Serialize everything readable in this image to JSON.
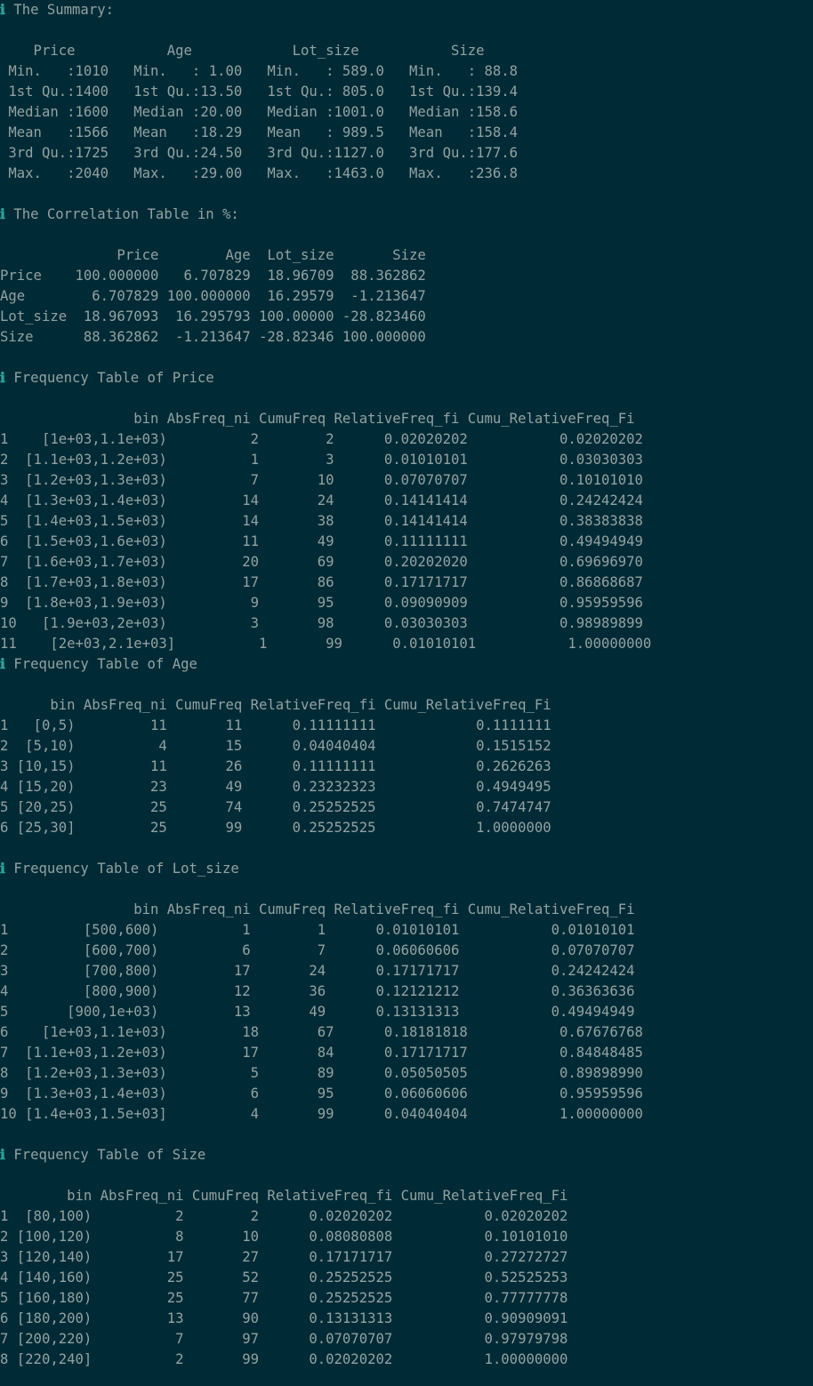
{
  "info_icon": "ℹ",
  "sections": [
    {
      "title": "The Summary:",
      "lines": [
        "",
        "    Price           Age            Lot_size           Size      ",
        " Min.   :1010   Min.   : 1.00   Min.   : 589.0   Min.   : 88.8  ",
        " 1st Qu.:1400   1st Qu.:13.50   1st Qu.: 805.0   1st Qu.:139.4  ",
        " Median :1600   Median :20.00   Median :1001.0   Median :158.6  ",
        " Mean   :1566   Mean   :18.29   Mean   : 989.5   Mean   :158.4  ",
        " 3rd Qu.:1725   3rd Qu.:24.50   3rd Qu.:1127.0   3rd Qu.:177.6  ",
        " Max.   :2040   Max.   :29.00   Max.   :1463.0   Max.   :236.8  ",
        ""
      ]
    },
    {
      "title": "The Correlation Table in %:",
      "lines": [
        "",
        "              Price        Age  Lot_size       Size",
        "Price    100.000000   6.707829  18.96709  88.362862",
        "Age        6.707829 100.000000  16.29579  -1.213647",
        "Lot_size  18.967093  16.295793 100.00000 -28.823460",
        "Size      88.362862  -1.213647 -28.82346 100.000000",
        ""
      ]
    },
    {
      "title": "Frequency Table of Price",
      "lines": [
        "",
        "                bin AbsFreq_ni CumuFreq RelativeFreq_fi Cumu_RelativeFreq_Fi",
        "1    [1e+03,1.1e+03)          2        2      0.02020202           0.02020202",
        "2  [1.1e+03,1.2e+03)          1        3      0.01010101           0.03030303",
        "3  [1.2e+03,1.3e+03)          7       10      0.07070707           0.10101010",
        "4  [1.3e+03,1.4e+03)         14       24      0.14141414           0.24242424",
        "5  [1.4e+03,1.5e+03)         14       38      0.14141414           0.38383838",
        "6  [1.5e+03,1.6e+03)         11       49      0.11111111           0.49494949",
        "7  [1.6e+03,1.7e+03)         20       69      0.20202020           0.69696970",
        "8  [1.7e+03,1.8e+03)         17       86      0.17171717           0.86868687",
        "9  [1.8e+03,1.9e+03)          9       95      0.09090909           0.95959596",
        "10   [1.9e+03,2e+03)          3       98      0.03030303           0.98989899",
        "11    [2e+03,2.1e+03]          1       99      0.01010101           1.00000000"
      ]
    },
    {
      "title": "Frequency Table of Age",
      "lines": [
        "",
        "      bin AbsFreq_ni CumuFreq RelativeFreq_fi Cumu_RelativeFreq_Fi",
        "1   [0,5)         11       11      0.11111111            0.1111111",
        "2  [5,10)          4       15      0.04040404            0.1515152",
        "3 [10,15)         11       26      0.11111111            0.2626263",
        "4 [15,20)         23       49      0.23232323            0.4949495",
        "5 [20,25)         25       74      0.25252525            0.7474747",
        "6 [25,30]         25       99      0.25252525            1.0000000",
        ""
      ]
    },
    {
      "title": "Frequency Table of Lot_size",
      "lines": [
        "",
        "                bin AbsFreq_ni CumuFreq RelativeFreq_fi Cumu_RelativeFreq_Fi",
        "1         [500,600)          1        1      0.01010101           0.01010101",
        "2         [600,700)          6        7      0.06060606           0.07070707",
        "3         [700,800)         17       24      0.17171717           0.24242424",
        "4         [800,900)         12       36      0.12121212           0.36363636",
        "5       [900,1e+03)         13       49      0.13131313           0.49494949",
        "6    [1e+03,1.1e+03)         18       67      0.18181818           0.67676768",
        "7  [1.1e+03,1.2e+03)         17       84      0.17171717           0.84848485",
        "8  [1.2e+03,1.3e+03)          5       89      0.05050505           0.89898990",
        "9  [1.3e+03,1.4e+03)          6       95      0.06060606           0.95959596",
        "10 [1.4e+03,1.5e+03]          4       99      0.04040404           1.00000000",
        ""
      ]
    },
    {
      "title": "Frequency Table of Size",
      "lines": [
        "",
        "        bin AbsFreq_ni CumuFreq RelativeFreq_fi Cumu_RelativeFreq_Fi",
        "1  [80,100)          2        2      0.02020202           0.02020202",
        "2 [100,120)          8       10      0.08080808           0.10101010",
        "3 [120,140)         17       27      0.17171717           0.27272727",
        "4 [140,160)         25       52      0.25252525           0.52525253",
        "5 [160,180)         25       77      0.25252525           0.77777778",
        "6 [180,200)         13       90      0.13131313           0.90909091",
        "7 [200,220)          7       97      0.07070707           0.97979798",
        "8 [220,240]          2       99      0.02020202           1.00000000"
      ]
    }
  ]
}
